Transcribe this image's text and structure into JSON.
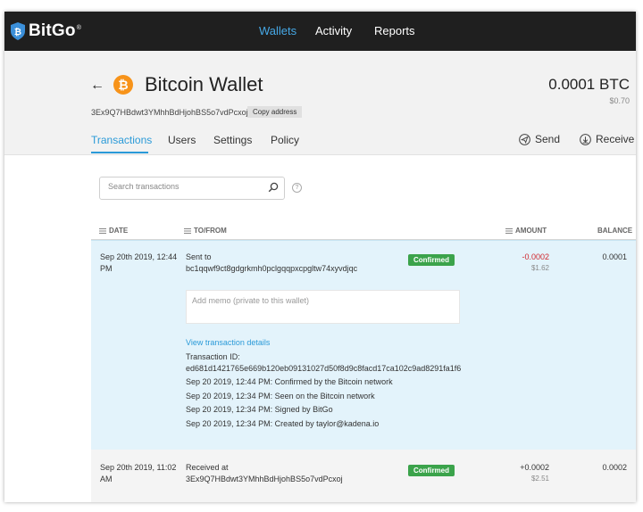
{
  "brand": {
    "name": "BitGo",
    "reg": "®"
  },
  "nav": {
    "wallets": "Wallets",
    "activity": "Activity",
    "reports": "Reports"
  },
  "wallet": {
    "back": "←",
    "coin_symbol": "₿",
    "title": "Bitcoin Wallet",
    "address": "3Ex9Q7HBdwt3YMhhBdHjohBS5o7vdPcxoj",
    "copy_label": "Copy address",
    "balance_btc": "0.0001 BTC",
    "balance_usd": "$0.70"
  },
  "tabs": [
    "Transactions",
    "Users",
    "Settings",
    "Policy"
  ],
  "actions": {
    "send": "Send",
    "receive": "Receive"
  },
  "search": {
    "placeholder": "Search transactions",
    "help": "?"
  },
  "columns": {
    "date": "DATE",
    "to_from": "TO/FROM",
    "amount": "AMOUNT",
    "balance": "BALANCE"
  },
  "transactions": [
    {
      "date_line1": "Sep 20th 2019, 12:44",
      "date_line2": "PM",
      "direction": "Sent to",
      "counterparty": "bc1qqwf9ct8gdgrkmh0pclgqqpxcpgltw74xyvdjqc",
      "status": "Confirmed",
      "amount": "-0.0002",
      "amount_usd": "$1.62",
      "balance": "0.0001",
      "memo_placeholder": "Add memo (private to this wallet)",
      "details_link": "View transaction details",
      "txid_label": "Transaction ID:",
      "txid": "ed681d1421765e669b120eb09131027d50f8d9c8facd17ca102c9ad8291fa1f6",
      "history": [
        "Sep 20 2019, 12:44 PM: Confirmed by the Bitcoin network",
        "Sep 20 2019, 12:34 PM: Seen on the Bitcoin network",
        "Sep 20 2019, 12:34 PM: Signed by BitGo",
        "Sep 20 2019, 12:34 PM: Created by taylor@kadena.io"
      ]
    },
    {
      "date_line1": "Sep 20th 2019, 11:02",
      "date_line2": "AM",
      "direction": "Received at",
      "counterparty": "3Ex9Q7HBdwt3YMhhBdHjohBS5o7vdPcxoj",
      "status": "Confirmed",
      "amount": "+0.0002",
      "amount_usd": "$2.51",
      "balance": "0.0002"
    }
  ],
  "colors": {
    "accent": "#2a9ad8",
    "confirmed": "#3ba34b",
    "negative": "#d0282e",
    "bitcoin": "#f7931a",
    "topbar": "#1f1f1f"
  }
}
